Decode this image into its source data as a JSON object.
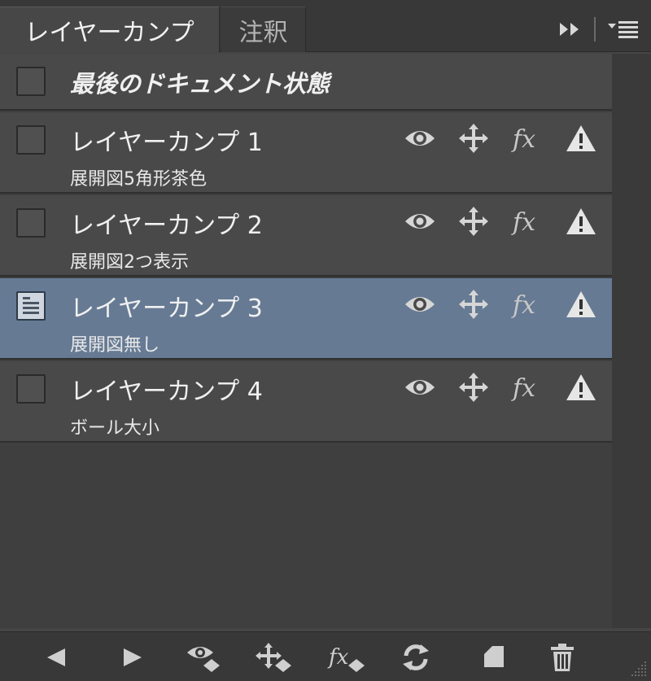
{
  "tabs": [
    {
      "label": "レイヤーカンプ"
    },
    {
      "label": "注釈"
    }
  ],
  "last_document_state": {
    "label": "最後のドキュメント状態"
  },
  "comps": [
    {
      "title": "レイヤーカンプ 1",
      "note": "展開図5角形茶色",
      "selected": false
    },
    {
      "title": "レイヤーカンプ 2",
      "note": "展開図2つ表示",
      "selected": false
    },
    {
      "title": "レイヤーカンプ 3",
      "note": "展開図無し",
      "selected": true
    },
    {
      "title": "レイヤーカンプ 4",
      "note": "ボール大小",
      "selected": false
    }
  ],
  "row_icons": [
    "visibility-icon",
    "position-icon",
    "fx-icon",
    "warning-icon"
  ],
  "toolbar": [
    "previous-comp-icon",
    "next-comp-icon",
    "update-visibility-icon",
    "update-position-icon",
    "update-appearance-icon",
    "refresh-icon",
    "new-comp-icon",
    "delete-icon"
  ],
  "colors": {
    "panel_bg": "#454545",
    "row_bg": "#494949",
    "selected_row": "#667a94",
    "text": "#f0f0f0"
  }
}
